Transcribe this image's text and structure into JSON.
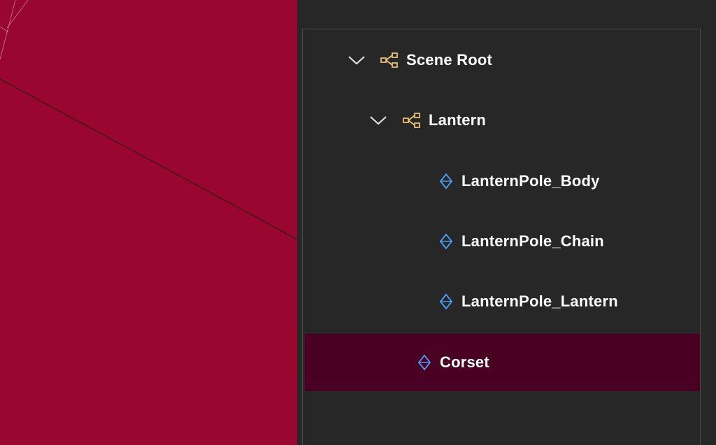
{
  "colors": {
    "viewport_bg": "#990731",
    "panel_bg": "#272727",
    "selection_bg": "#4a0022",
    "group_icon": "#e8c274",
    "mesh_icon": "#4aa3ff",
    "text": "#ffffff"
  },
  "scene_tree": {
    "items": [
      {
        "label": "Scene Root",
        "icon": "group-node-icon",
        "expanded": true
      },
      {
        "label": "Lantern",
        "icon": "group-node-icon",
        "expanded": true
      },
      {
        "label": "LanternPole_Body",
        "icon": "mesh-node-icon"
      },
      {
        "label": "LanternPole_Chain",
        "icon": "mesh-node-icon"
      },
      {
        "label": "LanternPole_Lantern",
        "icon": "mesh-node-icon"
      },
      {
        "label": "Corset",
        "icon": "mesh-node-icon",
        "selected": true
      }
    ]
  }
}
